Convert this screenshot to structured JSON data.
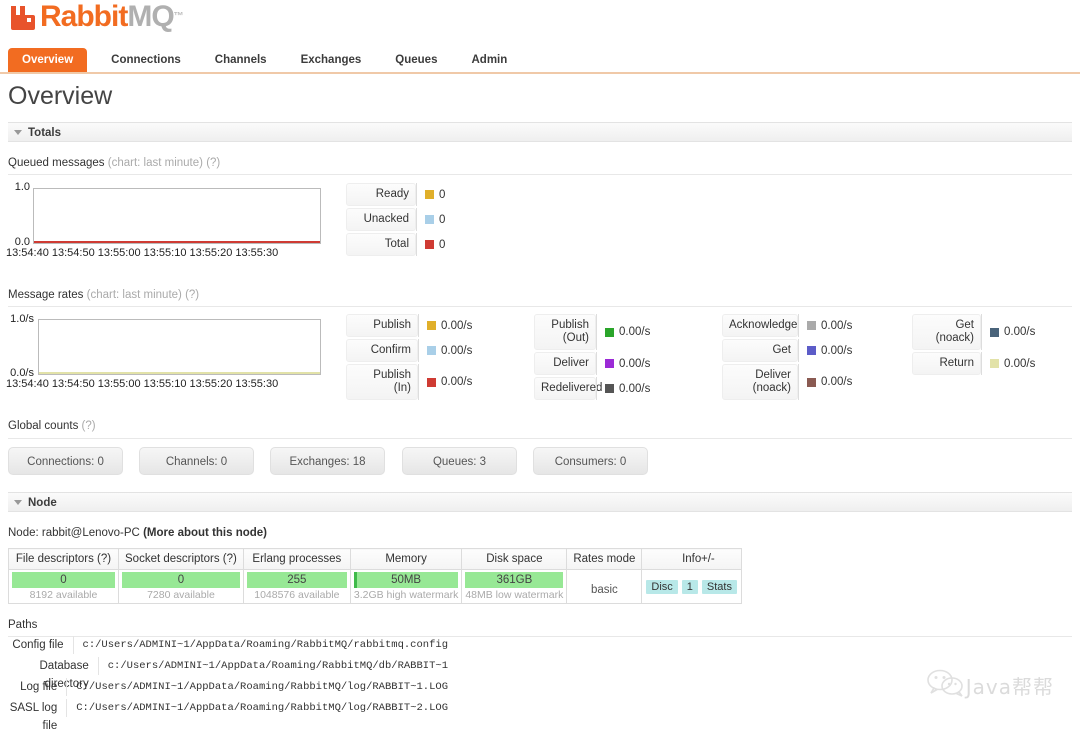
{
  "brand": {
    "name_part1": "Rabbit",
    "name_part2": "MQ",
    "trademark": "™",
    "logo_icon": "rabbitmq-logo-icon",
    "orange": "#f26c21",
    "gray": "#b0b0b0"
  },
  "nav": {
    "tabs": [
      {
        "label": "Overview",
        "active": true
      },
      {
        "label": "Connections",
        "active": false
      },
      {
        "label": "Channels",
        "active": false
      },
      {
        "label": "Exchanges",
        "active": false
      },
      {
        "label": "Queues",
        "active": false
      },
      {
        "label": "Admin",
        "active": false
      }
    ]
  },
  "page": {
    "title": "Overview"
  },
  "sections": {
    "totals": "Totals",
    "node": "Node",
    "paths": "Paths"
  },
  "queued_messages": {
    "label": "Queued messages",
    "chart_note": "(chart: last minute)",
    "help": "(?)",
    "legend": [
      {
        "key": "Ready",
        "value": "0",
        "color": "#e0af2a"
      },
      {
        "key": "Unacked",
        "value": "0",
        "color": "#a9cfe8"
      },
      {
        "key": "Total",
        "value": "0",
        "color": "#cf3b33"
      }
    ]
  },
  "message_rates": {
    "label": "Message rates",
    "chart_note": "(chart: last minute)",
    "help": "(?)",
    "columns": [
      [
        {
          "key": "Publish",
          "value": "0.00/s",
          "color": "#e0af2a"
        },
        {
          "key": "Confirm",
          "value": "0.00/s",
          "color": "#a9cfe8"
        },
        {
          "key": "Publish (In)",
          "value": "0.00/s",
          "color": "#cf3b33"
        }
      ],
      [
        {
          "key": "Publish (Out)",
          "value": "0.00/s",
          "color": "#2aa52a"
        },
        {
          "key": "Deliver",
          "value": "0.00/s",
          "color": "#9b2ad6"
        },
        {
          "key": "Redelivered",
          "value": "0.00/s",
          "color": "#555555"
        }
      ],
      [
        {
          "key": "Acknowledge",
          "value": "0.00/s",
          "color": "#aaaaaa"
        },
        {
          "key": "Get",
          "value": "0.00/s",
          "color": "#5c5cc8"
        },
        {
          "key": "Deliver (noack)",
          "value": "0.00/s",
          "color": "#8a5a52"
        }
      ],
      [
        {
          "key": "Get (noack)",
          "value": "0.00/s",
          "color": "#49637a"
        },
        {
          "key": "Return",
          "value": "0.00/s",
          "color": "#e2e2a8"
        }
      ]
    ]
  },
  "chart_data": [
    {
      "type": "line",
      "title": "Queued messages (chart: last minute)",
      "xlabel": "",
      "ylabel": "",
      "ylim": [
        0.0,
        1.0
      ],
      "ytick_labels": [
        "0.0",
        "1.0"
      ],
      "x": [
        "13:54:40",
        "13:54:50",
        "13:55:00",
        "13:55:10",
        "13:55:20",
        "13:55:30"
      ],
      "grid": false,
      "legend_position": "right",
      "series": [
        {
          "name": "Ready",
          "color": "#e0af2a",
          "values": [
            0,
            0,
            0,
            0,
            0,
            0
          ]
        },
        {
          "name": "Unacked",
          "color": "#a9cfe8",
          "values": [
            0,
            0,
            0,
            0,
            0,
            0
          ]
        },
        {
          "name": "Total",
          "color": "#cf3b33",
          "values": [
            0,
            0,
            0,
            0,
            0,
            0
          ]
        }
      ]
    },
    {
      "type": "line",
      "title": "Message rates (chart: last minute)",
      "xlabel": "",
      "ylabel": "",
      "ylim": [
        0.0,
        1.0
      ],
      "ytick_labels": [
        "0.0/s",
        "1.0/s"
      ],
      "x": [
        "13:54:40",
        "13:54:50",
        "13:55:00",
        "13:55:10",
        "13:55:20",
        "13:55:30"
      ],
      "grid": false,
      "legend_position": "right",
      "series": [
        {
          "name": "Publish",
          "color": "#e0af2a",
          "values": [
            0,
            0,
            0,
            0,
            0,
            0
          ]
        },
        {
          "name": "Confirm",
          "color": "#a9cfe8",
          "values": [
            0,
            0,
            0,
            0,
            0,
            0
          ]
        },
        {
          "name": "Publish (In)",
          "color": "#cf3b33",
          "values": [
            0,
            0,
            0,
            0,
            0,
            0
          ]
        },
        {
          "name": "Publish (Out)",
          "color": "#2aa52a",
          "values": [
            0,
            0,
            0,
            0,
            0,
            0
          ]
        },
        {
          "name": "Deliver",
          "color": "#9b2ad6",
          "values": [
            0,
            0,
            0,
            0,
            0,
            0
          ]
        },
        {
          "name": "Redelivered",
          "color": "#555555",
          "values": [
            0,
            0,
            0,
            0,
            0,
            0
          ]
        },
        {
          "name": "Acknowledge",
          "color": "#aaaaaa",
          "values": [
            0,
            0,
            0,
            0,
            0,
            0
          ]
        },
        {
          "name": "Get",
          "color": "#5c5cc8",
          "values": [
            0,
            0,
            0,
            0,
            0,
            0
          ]
        },
        {
          "name": "Deliver (noack)",
          "color": "#8a5a52",
          "values": [
            0,
            0,
            0,
            0,
            0,
            0
          ]
        },
        {
          "name": "Get (noack)",
          "color": "#49637a",
          "values": [
            0,
            0,
            0,
            0,
            0,
            0
          ]
        },
        {
          "name": "Return",
          "color": "#e2e2a8",
          "values": [
            0,
            0,
            0,
            0,
            0,
            0
          ]
        }
      ]
    }
  ],
  "global_counts": {
    "label": "Global counts",
    "help": "(?)",
    "items": [
      {
        "label": "Connections: 0"
      },
      {
        "label": "Channels: 0"
      },
      {
        "label": "Exchanges: 18"
      },
      {
        "label": "Queues: 3"
      },
      {
        "label": "Consumers: 0"
      }
    ]
  },
  "node": {
    "prefix": "Node:",
    "name": "rabbit@Lenovo-PC",
    "more_link": "(More about this node)",
    "headers": [
      "File descriptors (?)",
      "Socket descriptors (?)",
      "Erlang processes",
      "Memory",
      "Disk space",
      "Rates mode",
      "Info"
    ],
    "plus_minus": "+/-",
    "values": {
      "file_descriptors": "0",
      "file_descriptors_note": "8192 available",
      "socket_descriptors": "0",
      "socket_descriptors_note": "7280 available",
      "erlang_processes": "255",
      "erlang_processes_note": "1048576 available",
      "memory": "50MB",
      "memory_note": "3.2GB high watermark",
      "disk_space": "361GB",
      "disk_space_note": "48MB low watermark",
      "rates_mode": "basic"
    },
    "info_badges": [
      "Disc",
      "1",
      "Stats"
    ],
    "bar_color": "#97e895",
    "badge_color": "#b8e8e8"
  },
  "paths": {
    "rows": [
      {
        "label": "Config file",
        "value": "c:/Users/ADMINI~1/AppData/Roaming/RabbitMQ/rabbitmq.config"
      },
      {
        "label": "Database directory",
        "value": "c:/Users/ADMINI~1/AppData/Roaming/RabbitMQ/db/RABBIT~1"
      },
      {
        "label": "Log file",
        "value": "C:/Users/ADMINI~1/AppData/Roaming/RabbitMQ/log/RABBIT~1.LOG"
      },
      {
        "label": "SASL log file",
        "value": "C:/Users/ADMINI~1/AppData/Roaming/RabbitMQ/log/RABBIT~2.LOG"
      }
    ]
  },
  "watermark": {
    "icon": "wechat-icon",
    "text": "Java帮帮"
  }
}
